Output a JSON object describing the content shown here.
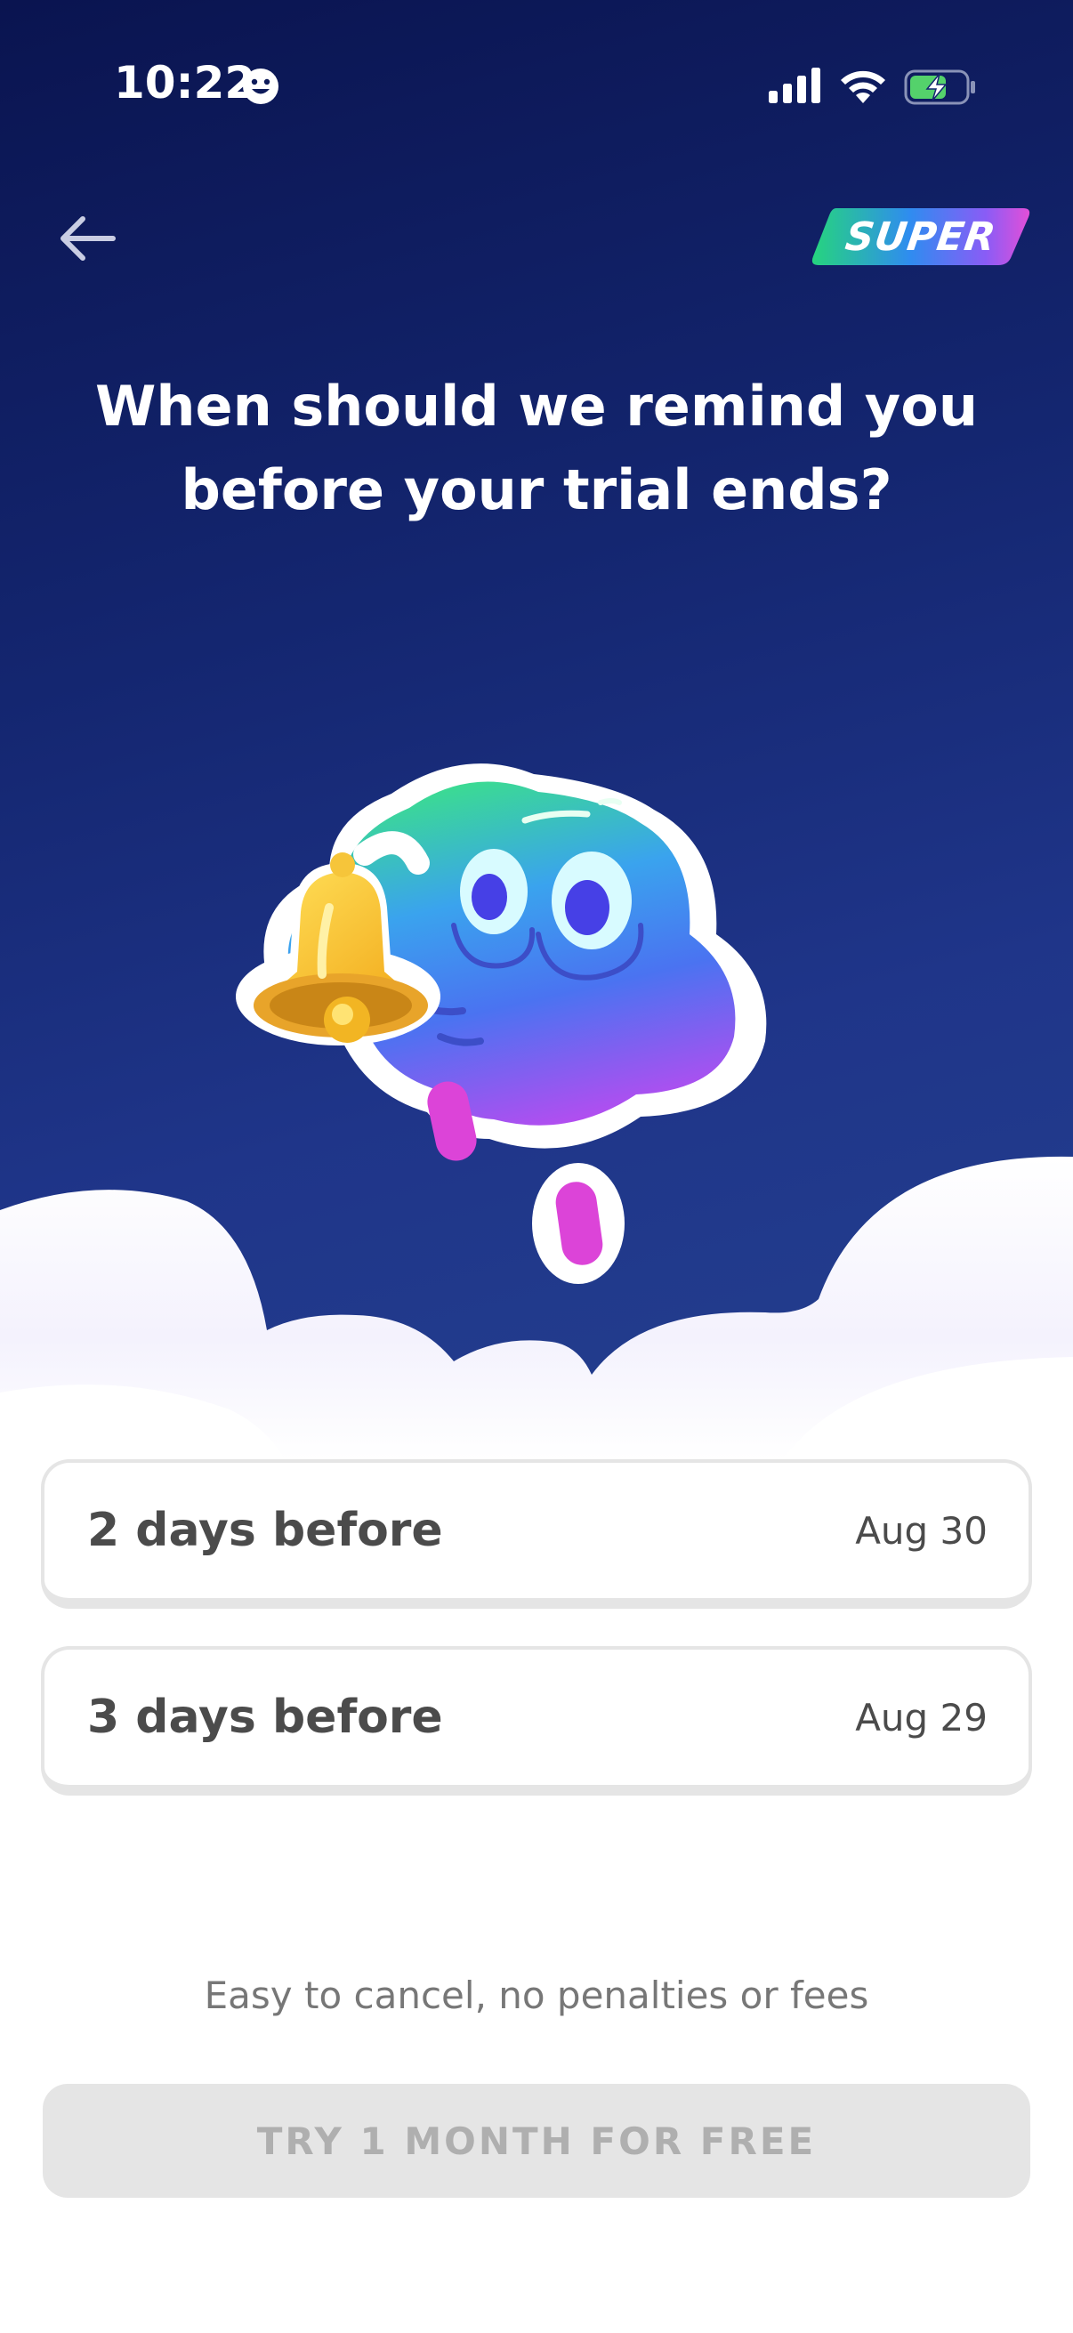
{
  "status_bar": {
    "time": "10:22",
    "smiley_icon": "smiley-icon",
    "signal_icon": "cellular-signal-icon",
    "wifi_icon": "wifi-icon",
    "battery_icon": "battery-charging-icon"
  },
  "header": {
    "back_icon": "arrow-left-icon",
    "badge_label": "SUPER"
  },
  "headline": {
    "line1": "When should we remind you",
    "line2": "before your trial ends?"
  },
  "illustration": {
    "name": "mascot-with-bell"
  },
  "options": [
    {
      "label": "2 days before",
      "date": "Aug 30"
    },
    {
      "label": "3 days before",
      "date": "Aug 29"
    }
  ],
  "footer": {
    "note": "Easy to cancel, no penalties or fees",
    "cta_label": "TRY 1 MONTH FOR FREE"
  },
  "colors": {
    "hero_top": "#0a1450",
    "hero_bottom": "#24408f",
    "text_dark": "#4b4b4b",
    "text_muted": "#777777",
    "cta_disabled_bg": "#e5e5e5",
    "cta_disabled_text": "#afafaf",
    "border": "#e5e5e5"
  }
}
